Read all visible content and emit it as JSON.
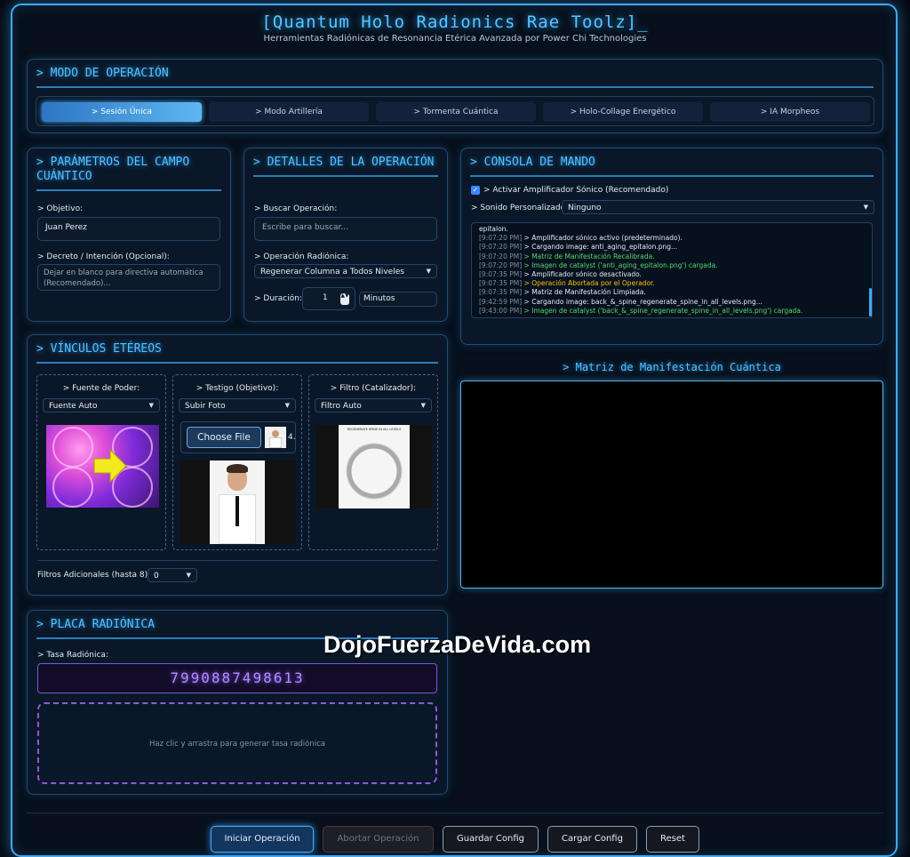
{
  "app": {
    "title": "[Quantum Holo Radionics Rae Toolz]_",
    "subtitle": "Herramientas Radiónicas de Resonancia Etérica Avanzada por Power Chi Technologies"
  },
  "mode": {
    "title": "> MODO DE OPERACIÓN",
    "tabs": [
      "> Sesión Única",
      "> Modo Artillería",
      "> Tormenta Cuántica",
      "> Holo-Collage Energético",
      "> IA Morpheos"
    ],
    "active_tab": 0
  },
  "params": {
    "title": "> PARÁMETROS DEL CAMPO CUÁNTICO",
    "objective_label": "> Objetivo:",
    "objective_value": "Juan Perez",
    "decree_label": "> Decreto / Intención (Opcional):",
    "decree_placeholder": "Dejar en blanco para directiva automática (Recomendado)..."
  },
  "details": {
    "title": "> DETALLES DE LA OPERACIÓN",
    "search_label": "> Buscar Operación:",
    "search_placeholder": "Escribe para buscar...",
    "op_label": "> Operación Radiónica:",
    "op_value": "Regenerar Columna a Todos Niveles",
    "duration_label": "> Duración:",
    "duration_value": "1",
    "duration_unit": "Minutos"
  },
  "console": {
    "title": "> CONSOLA DE MANDO",
    "amp_label": "> Activar Amplificador Sónico (Recomendado)",
    "amp_checked": true,
    "sound_label": "> Sonido Personalizado:",
    "sound_value": "Ninguno",
    "logs": [
      {
        "ts": "",
        "msg": "epitalon.",
        "kind": "w"
      },
      {
        "ts": "[9:07:20 PM]",
        "msg": "> Amplificador sónico activo (predeterminado).",
        "kind": "w"
      },
      {
        "ts": "[9:07:20 PM]",
        "msg": "> Cargando image: anti_aging_epitalon.png...",
        "kind": "w"
      },
      {
        "ts": "[9:07:20 PM]",
        "msg": "> Matriz de Manifestación Recalibrada.",
        "kind": "g"
      },
      {
        "ts": "[9:07:20 PM]",
        "msg": "> Imagen de catalyst ('anti_aging_epitalon.png') cargada.",
        "kind": "g"
      },
      {
        "ts": "[9:07:35 PM]",
        "msg": "> Amplificador sónico desactivado.",
        "kind": "w"
      },
      {
        "ts": "[9:07:35 PM]",
        "msg": "> Operación Abortada por el Operador.",
        "kind": "y"
      },
      {
        "ts": "[9:07:35 PM]",
        "msg": "> Matriz de Manifestación Limpiada.",
        "kind": "w"
      },
      {
        "ts": "[9:42:59 PM]",
        "msg": "> Cargando image: back_&_spine_regenerate_spine_in_all_levels.png...",
        "kind": "w"
      },
      {
        "ts": "[9:43:00 PM]",
        "msg": "> Imagen de catalyst ('back_&_spine_regenerate_spine_in_all_levels.png') cargada.",
        "kind": "g"
      }
    ]
  },
  "links": {
    "title": "> VÍNCULOS ETÉREOS",
    "power_label": "> Fuente de Poder:",
    "power_value": "Fuente Auto",
    "witness_label": "> Testigo (Objetivo):",
    "witness_value": "Subir Foto",
    "choose_file": "Choose File",
    "file_count": "4.",
    "filter_label": "> Filtro (Catalizador):",
    "filter_value": "Filtro Auto",
    "catalyst_caption": "REGENERATE SPINE IN ALL LEVELS",
    "extra_filters_label": "Filtros Adicionales (hasta 8):",
    "extra_filters_value": "0"
  },
  "matrix": {
    "title": "> Matriz de Manifestación Cuántica"
  },
  "plate": {
    "title": "> PLACA RADIÓNICA",
    "rate_label": "> Tasa Radiónica:",
    "rate_value": "7990887498613",
    "drop_hint": "Haz clic y arrastra para generar tasa radiónica"
  },
  "watermark": "DojoFuerzaDeVida.com",
  "footer": {
    "start": "Iniciar Operación",
    "abort": "Abortar Operación",
    "save": "Guardar Config",
    "load": "Cargar Config",
    "reset": "Reset"
  },
  "colors": {
    "accent": "#3fa9f5",
    "log_green": "#55d86a",
    "log_yellow": "#f0c419",
    "rate_purple": "#b58cff"
  }
}
